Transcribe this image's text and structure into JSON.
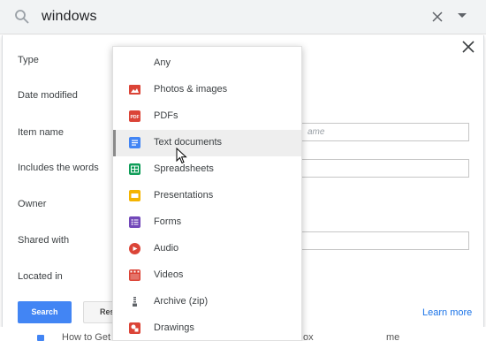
{
  "search": {
    "query": "windows"
  },
  "panel": {
    "labels": {
      "type": "Type",
      "date_modified": "Date modified",
      "item_name": "Item name",
      "includes_words": "Includes the words",
      "owner": "Owner",
      "shared_with": "Shared with",
      "located_in": "Located in"
    },
    "item_name_placeholder": "ame",
    "search_button": "Search",
    "reset_button": "Reset",
    "learn_more": "Learn more"
  },
  "behind_row": {
    "text_left": "How to Get",
    "text_mid": "ox",
    "text_right": "me"
  },
  "dropdown": {
    "options": [
      {
        "label": "Any",
        "icon": "none"
      },
      {
        "label": "Photos & images",
        "icon": "image-icon",
        "color": "#db4437"
      },
      {
        "label": "PDFs",
        "icon": "pdf-icon",
        "color": "#db4437"
      },
      {
        "label": "Text documents",
        "icon": "document-icon",
        "color": "#4285f4",
        "selected": true
      },
      {
        "label": "Spreadsheets",
        "icon": "spreadsheet-icon",
        "color": "#0f9d58"
      },
      {
        "label": "Presentations",
        "icon": "presentation-icon",
        "color": "#f4b400"
      },
      {
        "label": "Forms",
        "icon": "forms-icon",
        "color": "#7248b9"
      },
      {
        "label": "Audio",
        "icon": "audio-icon",
        "color": "#db4437"
      },
      {
        "label": "Videos",
        "icon": "video-icon",
        "color": "#db4437"
      },
      {
        "label": "Archive (zip)",
        "icon": "archive-icon",
        "color": "#5f6368"
      },
      {
        "label": "Drawings",
        "icon": "drawing-icon",
        "color": "#db4437"
      }
    ]
  },
  "colors": {
    "accent": "#4285f4",
    "link": "#1a73e8"
  }
}
